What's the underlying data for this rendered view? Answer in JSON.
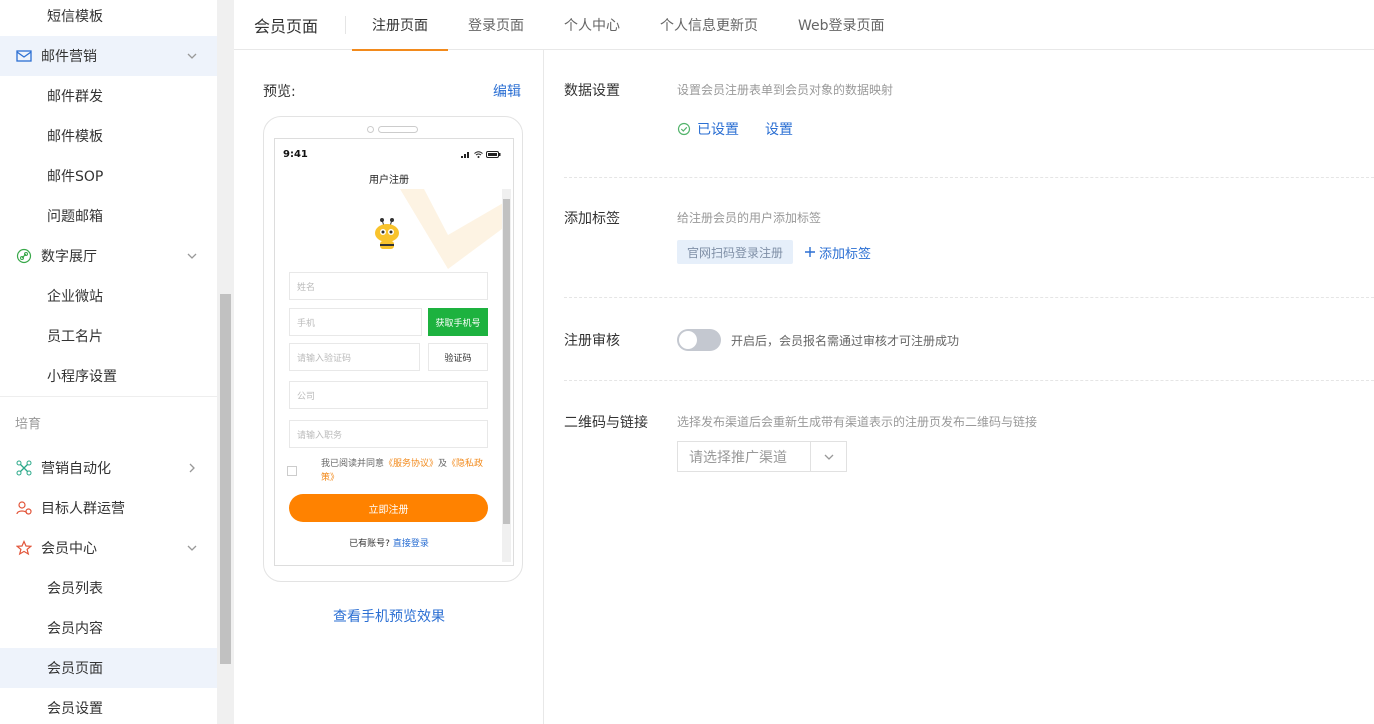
{
  "sidebar": {
    "items": [
      {
        "label": "短信模板"
      },
      {
        "label": "邮件营销"
      },
      {
        "label": "邮件群发"
      },
      {
        "label": "邮件模板"
      },
      {
        "label": "邮件SOP"
      },
      {
        "label": "问题邮箱"
      },
      {
        "label": "数字展厅"
      },
      {
        "label": "企业微站"
      },
      {
        "label": "员工名片"
      },
      {
        "label": "小程序设置"
      },
      {
        "label": "营销自动化"
      },
      {
        "label": "目标人群运营"
      },
      {
        "label": "会员中心"
      },
      {
        "label": "会员列表"
      },
      {
        "label": "会员内容"
      },
      {
        "label": "会员页面"
      },
      {
        "label": "会员设置"
      }
    ],
    "section_label": "培育"
  },
  "header": {
    "title": "会员页面",
    "tabs": [
      {
        "label": "注册页面"
      },
      {
        "label": "登录页面"
      },
      {
        "label": "个人中心"
      },
      {
        "label": "个人信息更新页"
      },
      {
        "label": "Web登录页面"
      }
    ]
  },
  "preview": {
    "label": "预览:",
    "edit": "编辑",
    "view_link": "查看手机预览效果",
    "phone": {
      "time": "9:41",
      "title": "用户注册",
      "name_placeholder": "姓名",
      "phone_placeholder": "手机",
      "get_phone_btn": "获取手机号",
      "code_placeholder": "请输入验证码",
      "code_btn": "验证码",
      "company_placeholder": "公司",
      "position_placeholder": "请输入职务",
      "agree_prefix": "我已阅读并同意",
      "service_link": "《服务协议》",
      "and": "及",
      "privacy_link": "《隐私政策》",
      "register_btn": "立即注册",
      "have_account": "已有账号?",
      "login_link": "直接登录"
    }
  },
  "settings": {
    "data": {
      "label": "数据设置",
      "desc": "设置会员注册表单到会员对象的数据映射",
      "status": "已设置",
      "action": "设置"
    },
    "tags": {
      "label": "添加标签",
      "desc": "给注册会员的用户添加标签",
      "tag": "官网扫码登录注册",
      "add": "添加标签"
    },
    "review": {
      "label": "注册审核",
      "desc": "开启后，会员报名需通过审核才可注册成功",
      "enabled": false
    },
    "qrcode": {
      "label": "二维码与链接",
      "desc": "选择发布渠道后会重新生成带有渠道表示的注册页发布二维码与链接",
      "placeholder": "请选择推广渠道"
    }
  },
  "colors": {
    "accent": "#f28a1c",
    "link": "#2b6fd3",
    "green": "#1db23f",
    "register": "#ff8200"
  }
}
